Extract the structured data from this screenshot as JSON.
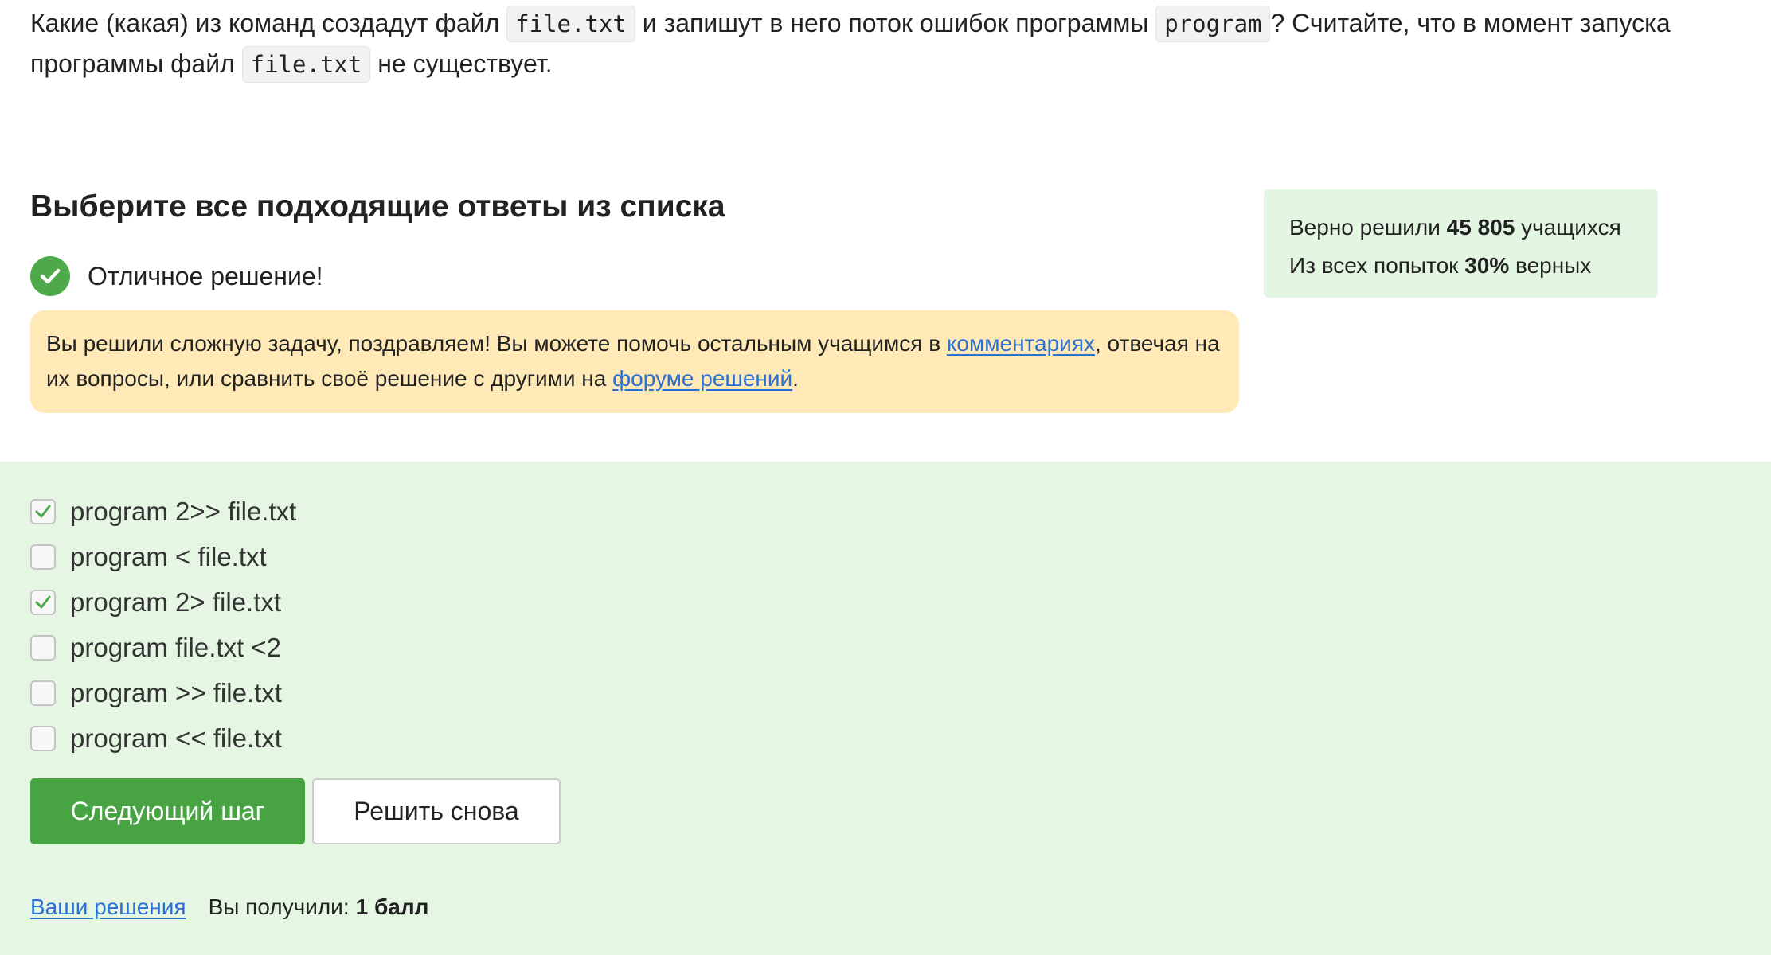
{
  "question": {
    "part1": "Какие (какая) из команд создадут файл",
    "code1": "file.txt",
    "part2": "и запишут в него поток ошибок программы",
    "code2": "program",
    "part3": "? Считайте, что в момент запуска программы файл",
    "code3": "file.txt",
    "part4": "не существует."
  },
  "select_title": "Выберите все подходящие ответы из списка",
  "success": {
    "text": "Отличное решение!",
    "icon": "check-circle-icon",
    "color": "#4ea94a"
  },
  "congrats": {
    "part1": "Вы решили сложную задачу, поздравляем! Вы можете помочь остальным учащимся в",
    "link1": "комментариях",
    "part2": ", отвечая на их вопросы, или сравнить своё решение с другими на",
    "link2": "форуме решений",
    "part3": "."
  },
  "stats": {
    "line1_prefix": "Верно решили",
    "solved_count": "45 805",
    "line1_suffix": "учащихся",
    "line2_prefix": "Из всех попыток",
    "percent": "30%",
    "line2_suffix": "верных"
  },
  "options": [
    {
      "label": "program 2>> file.txt",
      "checked": true
    },
    {
      "label": "program < file.txt",
      "checked": false
    },
    {
      "label": "program 2> file.txt",
      "checked": true
    },
    {
      "label": "program file.txt <2",
      "checked": false
    },
    {
      "label": "program >> file.txt",
      "checked": false
    },
    {
      "label": "program << file.txt",
      "checked": false
    }
  ],
  "buttons": {
    "next": "Следующий шаг",
    "retry": "Решить снова"
  },
  "footer": {
    "solutions_link": "Ваши решения",
    "score_label": "Вы получили:",
    "score": "1 балл"
  },
  "colors": {
    "accent_green": "#48a343",
    "link": "#2a70d2",
    "notice_bg": "#ffe9b6",
    "answer_bg": "#e5f7e3"
  }
}
